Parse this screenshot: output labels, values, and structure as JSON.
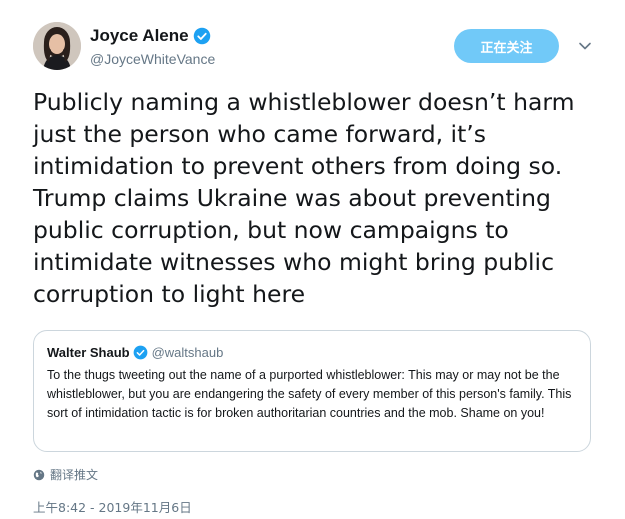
{
  "author": {
    "display_name": "Joyce Alene",
    "handle": "@JoyceWhiteVance",
    "verified": true
  },
  "follow_button": {
    "label": "正在关注"
  },
  "tweet": {
    "text": "Publicly naming a whistleblower doesn’t harm just the person who came forward, it’s intimidation to prevent others from doing so. Trump claims Ukraine was about preventing public corruption, but now campaigns to intimidate witnesses who might bring public corruption to light here"
  },
  "quoted_tweet": {
    "display_name": "Walter Shaub",
    "handle": "@waltshaub",
    "verified": true,
    "text": "To the thugs tweeting out the name of a purported whistleblower: This may or may not be the whistleblower, but you are endangering the safety of every member of this person's family. This sort of intimidation tactic is for broken authoritarian countries and the mob. Shame on you!"
  },
  "translate_label": "翻译推文",
  "timestamp": "上午8:42 - 2019年11月6日",
  "colors": {
    "accent": "#1da1f2",
    "follow_bg": "#71c9f8",
    "secondary_text": "#657786",
    "border": "#ccd6dd"
  },
  "icons": {
    "verified": "verified-badge-icon",
    "caret": "chevron-down-icon",
    "globe": "globe-icon"
  }
}
